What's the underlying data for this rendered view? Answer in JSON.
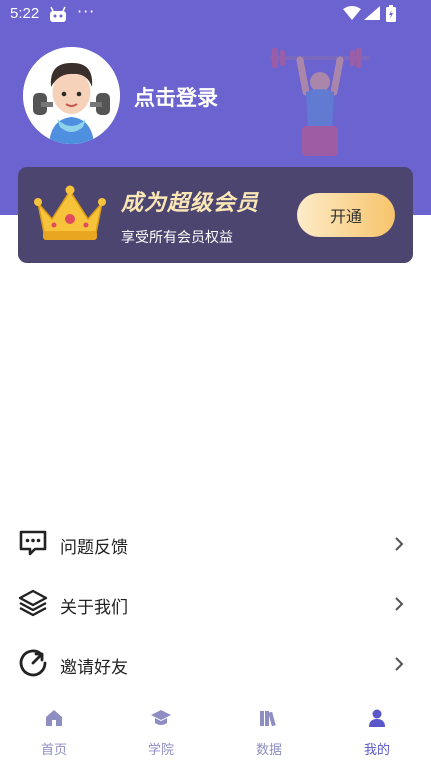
{
  "status_bar": {
    "time": "5:22",
    "dots": "···"
  },
  "profile": {
    "login_text": "点击登录"
  },
  "vip": {
    "title": "成为超级会员",
    "subtitle": "享受所有会员权益",
    "button_label": "开通"
  },
  "menu": [
    {
      "label": "问题反馈",
      "icon": "feedback-message-icon"
    },
    {
      "label": "关于我们",
      "icon": "layers-icon"
    },
    {
      "label": "邀请好友",
      "icon": "share-refresh-icon"
    }
  ],
  "tabs": [
    {
      "label": "首页",
      "icon": "home-icon",
      "active": false
    },
    {
      "label": "学院",
      "icon": "graduation-cap-icon",
      "active": false
    },
    {
      "label": "数据",
      "icon": "books-icon",
      "active": false
    },
    {
      "label": "我的",
      "icon": "person-icon",
      "active": true
    }
  ],
  "colors": {
    "header": "#6a63d0",
    "vip_card": "#4c4570",
    "active_tab": "#5b57c9",
    "inactive_tab": "#8e8ec2"
  }
}
